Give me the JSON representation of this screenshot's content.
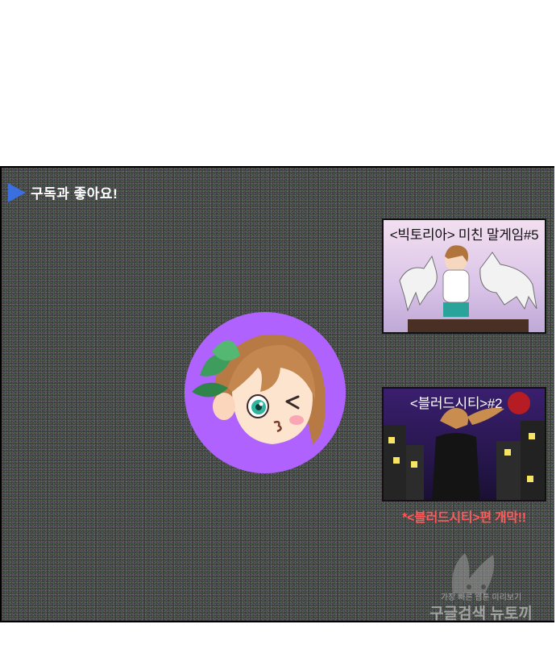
{
  "subscribe": {
    "text": "구독과 좋아요!"
  },
  "thumbnails": [
    {
      "title": "<빅토리아> 미친 말게임#5"
    },
    {
      "title": "<블러드시티>#2"
    }
  ],
  "notice": "*<블러드시티>편 개막!!",
  "watermark": {
    "line1": "가장 빠른 웹툰 미리보기",
    "line2": "구글검색 뉴토끼"
  },
  "colors": {
    "triangle": "#3b6fe0",
    "avatar_bg": "#b062ff",
    "notice": "#ff5a5a"
  }
}
